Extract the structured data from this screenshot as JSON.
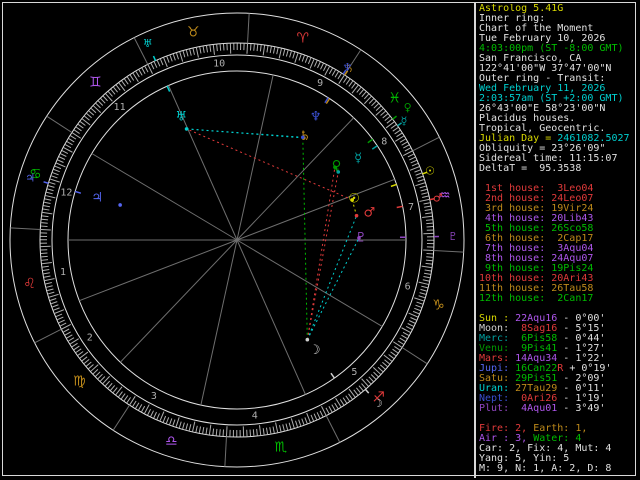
{
  "palette": {
    "white": "#E0E0E0",
    "ltgray": "#CFCFCF",
    "gray": "#AFAFAF",
    "dkgray": "#6E6E6E",
    "red": "#E03A3A",
    "yellow": "#D9D900",
    "green": "#00BB00",
    "dkgreen": "#009900",
    "cyan": "#00CFCF",
    "dkcyan": "#009F9F",
    "blue": "#5566F2",
    "dkblue": "#3A4FD0",
    "purple": "#AE56EC",
    "dkpurple": "#8F46C0",
    "brown": "#BE8A1A"
  },
  "sidebar": {
    "lines": [
      {
        "name": "app-title",
        "segs": [
          {
            "t": "Astrolog 5.41G",
            "c": "yellow"
          }
        ]
      },
      {
        "name": "info-line",
        "segs": [
          {
            "t": "Inner ring:",
            "c": "white"
          }
        ]
      },
      {
        "name": "info-line",
        "segs": [
          {
            "t": "Chart of the Moment",
            "c": "white"
          }
        ]
      },
      {
        "name": "inner-date",
        "segs": [
          {
            "t": "Tue February 10, 2026",
            "c": "white"
          }
        ]
      },
      {
        "name": "inner-time",
        "segs": [
          {
            "t": "4:03:00pm (ST -8:00 GMT)",
            "c": "green"
          }
        ]
      },
      {
        "name": "inner-location",
        "segs": [
          {
            "t": "San Francisco, CA",
            "c": "white"
          }
        ]
      },
      {
        "name": "inner-coords",
        "segs": [
          {
            "t": "122°41'00\"W 37°47'00\"N",
            "c": "white"
          }
        ]
      },
      {
        "name": "info-line",
        "segs": [
          {
            "t": "Outer ring - Transit:",
            "c": "white"
          }
        ]
      },
      {
        "name": "outer-date",
        "segs": [
          {
            "t": "Wed February 11, 2026",
            "c": "cyan"
          }
        ]
      },
      {
        "name": "outer-time",
        "segs": [
          {
            "t": "2:03:57am (ST +2:00 GMT)",
            "c": "cyan"
          }
        ]
      },
      {
        "name": "outer-coords",
        "segs": [
          {
            "t": "26°43'00\"E 58°23'00\"N",
            "c": "white"
          }
        ]
      },
      {
        "name": "house-system",
        "segs": [
          {
            "t": "Placidus houses.",
            "c": "white"
          }
        ]
      },
      {
        "name": "zodiac-system",
        "segs": [
          {
            "t": "Tropical, Geocentric.",
            "c": "white"
          }
        ]
      },
      {
        "name": "julian-day",
        "segs": [
          {
            "t": "Julian Day = ",
            "c": "yellow"
          },
          {
            "t": "2461082.5027",
            "c": "cyan"
          }
        ]
      },
      {
        "name": "obliquity",
        "segs": [
          {
            "t": "Obliquity = 23°26'09\"",
            "c": "white"
          }
        ]
      },
      {
        "name": "sidereal-time",
        "segs": [
          {
            "t": "Sidereal time: 11:15:07",
            "c": "white"
          }
        ]
      },
      {
        "name": "delta-t",
        "segs": [
          {
            "t": "DeltaT =  95.3538",
            "c": "white"
          }
        ]
      },
      {
        "name": "spacer",
        "segs": []
      },
      {
        "name": "house-cusp-row",
        "segs": [
          {
            "t": " 1st house:  3Leo04",
            "c": "red"
          }
        ]
      },
      {
        "name": "house-cusp-row",
        "segs": [
          {
            "t": " 2nd house: 24Leo07",
            "c": "red"
          }
        ]
      },
      {
        "name": "house-cusp-row",
        "segs": [
          {
            "t": " 3rd house: 19Vir24",
            "c": "brown"
          }
        ]
      },
      {
        "name": "house-cusp-row",
        "segs": [
          {
            "t": " 4th house: 20Lib43",
            "c": "purple"
          }
        ]
      },
      {
        "name": "house-cusp-row",
        "segs": [
          {
            "t": " 5th house: 26Sco58",
            "c": "green"
          }
        ]
      },
      {
        "name": "house-cusp-row",
        "segs": [
          {
            "t": " 6th house:  2Cap17",
            "c": "brown"
          }
        ]
      },
      {
        "name": "house-cusp-row",
        "segs": [
          {
            "t": " 7th house:  3Aqu04",
            "c": "purple"
          }
        ]
      },
      {
        "name": "house-cusp-row",
        "segs": [
          {
            "t": " 8th house: 24Aqu07",
            "c": "purple"
          }
        ]
      },
      {
        "name": "house-cusp-row",
        "segs": [
          {
            "t": " 9th house: 19Pis24",
            "c": "green"
          }
        ]
      },
      {
        "name": "house-cusp-row",
        "segs": [
          {
            "t": "10th house: 20Ari43",
            "c": "red"
          }
        ]
      },
      {
        "name": "house-cusp-row",
        "segs": [
          {
            "t": "11th house: 26Tau58",
            "c": "brown"
          }
        ]
      },
      {
        "name": "house-cusp-row",
        "segs": [
          {
            "t": "12th house:  2Can17",
            "c": "green"
          }
        ]
      },
      {
        "name": "spacer",
        "segs": []
      },
      {
        "name": "planet-row",
        "segs": [
          {
            "t": "Sun : ",
            "c": "yellow"
          },
          {
            "t": "22Aqu16",
            "c": "purple"
          },
          {
            "t": " - 0°00'",
            "c": "white"
          }
        ]
      },
      {
        "name": "planet-row",
        "segs": [
          {
            "t": "Moon: ",
            "c": "ltgray"
          },
          {
            "t": " 8Sag16",
            "c": "red"
          },
          {
            "t": " - 5°15'",
            "c": "white"
          }
        ]
      },
      {
        "name": "planet-row",
        "segs": [
          {
            "t": "Merc: ",
            "c": "dkcyan"
          },
          {
            "t": " 6Pis58",
            "c": "green"
          },
          {
            "t": " - 0°44'",
            "c": "white"
          }
        ]
      },
      {
        "name": "planet-row",
        "segs": [
          {
            "t": "Venu: ",
            "c": "dkgreen"
          },
          {
            "t": " 9Pis41",
            "c": "green"
          },
          {
            "t": " - 1°27'",
            "c": "white"
          }
        ]
      },
      {
        "name": "planet-row",
        "segs": [
          {
            "t": "Mars: ",
            "c": "red"
          },
          {
            "t": "14Aqu34",
            "c": "purple"
          },
          {
            "t": " - 1°22'",
            "c": "white"
          }
        ]
      },
      {
        "name": "planet-row",
        "segs": [
          {
            "t": "Jupi: ",
            "c": "blue"
          },
          {
            "t": "16Can22",
            "c": "green"
          },
          {
            "t": "R",
            "c": "red"
          },
          {
            "t": " + 0°19'",
            "c": "white"
          }
        ]
      },
      {
        "name": "planet-row",
        "segs": [
          {
            "t": "Satu: ",
            "c": "brown"
          },
          {
            "t": "29Pis51",
            "c": "green"
          },
          {
            "t": " - 2°09'",
            "c": "white"
          }
        ]
      },
      {
        "name": "planet-row",
        "segs": [
          {
            "t": "Uran: ",
            "c": "cyan"
          },
          {
            "t": "27Tau29",
            "c": "brown"
          },
          {
            "t": " - 0°11'",
            "c": "white"
          }
        ]
      },
      {
        "name": "planet-row",
        "segs": [
          {
            "t": "Nept: ",
            "c": "dkblue"
          },
          {
            "t": " 0Ari26",
            "c": "red"
          },
          {
            "t": " - 1°19'",
            "c": "white"
          }
        ]
      },
      {
        "name": "planet-row",
        "segs": [
          {
            "t": "Plut: ",
            "c": "dkpurple"
          },
          {
            "t": " 4Aqu01",
            "c": "purple"
          },
          {
            "t": " - 3°49'",
            "c": "white"
          }
        ]
      },
      {
        "name": "spacer",
        "segs": []
      },
      {
        "name": "stats-row",
        "segs": [
          {
            "t": "Fire: 2, ",
            "c": "red"
          },
          {
            "t": "Earth: 1,",
            "c": "brown"
          }
        ]
      },
      {
        "name": "stats-row",
        "segs": [
          {
            "t": "Air : 3, ",
            "c": "purple"
          },
          {
            "t": "Water: 4",
            "c": "green"
          }
        ]
      },
      {
        "name": "stats-row",
        "segs": [
          {
            "t": "Car: 2, Fix: 4, Mut: 4",
            "c": "white"
          }
        ]
      },
      {
        "name": "stats-row",
        "segs": [
          {
            "t": "Yang: 5, Yin: 5",
            "c": "white"
          }
        ]
      },
      {
        "name": "stats-row",
        "segs": [
          {
            "t": "M: 9, N: 1, A: 2, D: 8",
            "c": "white"
          }
        ]
      }
    ]
  },
  "chart": {
    "type": "astrology-biwheel",
    "asc_lon": 123.067,
    "signs": [
      {
        "name": "aries",
        "glyph": "♈",
        "element": "red"
      },
      {
        "name": "taurus",
        "glyph": "♉",
        "element": "brown"
      },
      {
        "name": "gemini",
        "glyph": "♊",
        "element": "purple"
      },
      {
        "name": "cancer",
        "glyph": "♋",
        "element": "green"
      },
      {
        "name": "leo",
        "glyph": "♌",
        "element": "red"
      },
      {
        "name": "virgo",
        "glyph": "♍",
        "element": "brown"
      },
      {
        "name": "libra",
        "glyph": "♎",
        "element": "purple"
      },
      {
        "name": "scorpio",
        "glyph": "♏",
        "element": "green"
      },
      {
        "name": "sagittarius",
        "glyph": "♐",
        "element": "red"
      },
      {
        "name": "capricorn",
        "glyph": "♑",
        "element": "brown"
      },
      {
        "name": "aquarius",
        "glyph": "♒",
        "element": "purple"
      },
      {
        "name": "pisces",
        "glyph": "♓",
        "element": "green"
      }
    ],
    "houses": [
      {
        "num": 1,
        "cusp": "3Leo04",
        "lon": 123.067
      },
      {
        "num": 2,
        "cusp": "24Leo07",
        "lon": 144.117
      },
      {
        "num": 3,
        "cusp": "19Vir24",
        "lon": 169.4
      },
      {
        "num": 4,
        "cusp": "20Lib43",
        "lon": 200.717
      },
      {
        "num": 5,
        "cusp": "26Sco58",
        "lon": 236.967
      },
      {
        "num": 6,
        "cusp": "2Cap17",
        "lon": 272.283
      },
      {
        "num": 7,
        "cusp": "3Aqu04",
        "lon": 303.067
      },
      {
        "num": 8,
        "cusp": "24Aqu07",
        "lon": 324.117
      },
      {
        "num": 9,
        "cusp": "19Pis24",
        "lon": 349.4
      },
      {
        "num": 10,
        "cusp": "20Ari43",
        "lon": 20.717
      },
      {
        "num": 11,
        "cusp": "26Tau58",
        "lon": 56.967
      },
      {
        "num": 12,
        "cusp": "2Can17",
        "lon": 92.283
      }
    ],
    "planets": [
      {
        "name": "sun",
        "glyph": "☉",
        "color": "yellow",
        "pos": "22Aqu16",
        "lon": 322.27,
        "transit_lon": 322.69,
        "retro": false
      },
      {
        "name": "moon",
        "glyph": "☽",
        "color": "ltgray",
        "pos": "8Sag16",
        "lon": 248.27,
        "transit_lon": 253.77,
        "retro": false
      },
      {
        "name": "merc",
        "glyph": "☿",
        "color": "dkcyan",
        "pos": "6Pis58",
        "lon": 336.97,
        "transit_lon": 338.5,
        "retro": false
      },
      {
        "name": "venu",
        "glyph": "♀",
        "color": "dkgreen",
        "pos": "9Pis41",
        "lon": 339.68,
        "transit_lon": 340.9,
        "retro": false
      },
      {
        "name": "mars",
        "glyph": "♂",
        "color": "red",
        "pos": "14Aqu34",
        "lon": 314.57,
        "transit_lon": 314.88,
        "retro": false
      },
      {
        "name": "jupi",
        "glyph": "♃",
        "color": "blue",
        "pos": "16Can22",
        "lon": 106.37,
        "transit_lon": 106.33,
        "retro": true
      },
      {
        "name": "satu",
        "glyph": "♄",
        "color": "brown",
        "pos": "29Pis51",
        "lon": 359.85,
        "transit_lon": 359.9,
        "retro": false
      },
      {
        "name": "uran",
        "glyph": "♅",
        "color": "cyan",
        "pos": "27Tau29",
        "lon": 57.48,
        "transit_lon": 57.49,
        "retro": false
      },
      {
        "name": "nept",
        "glyph": "♆",
        "color": "dkblue",
        "pos": "0Ari26",
        "lon": 0.43,
        "transit_lon": 0.45,
        "retro": false
      },
      {
        "name": "plut",
        "glyph": "♇",
        "color": "dkpurple",
        "pos": "4Aqu01",
        "lon": 304.02,
        "transit_lon": 304.05,
        "retro": false
      }
    ],
    "aspects": [
      {
        "a": "satu",
        "b": "nept",
        "type": "conjunction",
        "color": "yellow"
      },
      {
        "a": "merc",
        "b": "venu",
        "type": "conjunction",
        "color": "yellow"
      },
      {
        "a": "sun",
        "b": "mars",
        "type": "conjunction",
        "color": "yellow"
      },
      {
        "a": "uran",
        "b": "satu",
        "type": "sextile",
        "color": "cyan"
      },
      {
        "a": "uran",
        "b": "nept",
        "type": "sextile",
        "color": "cyan"
      },
      {
        "a": "moon",
        "b": "plut",
        "type": "sextile",
        "color": "cyan"
      },
      {
        "a": "moon",
        "b": "mars",
        "type": "sextile",
        "color": "cyan"
      },
      {
        "a": "moon",
        "b": "venu",
        "type": "square",
        "color": "red"
      },
      {
        "a": "moon",
        "b": "merc",
        "type": "square",
        "color": "red"
      },
      {
        "a": "sun",
        "b": "uran",
        "type": "square",
        "color": "red"
      },
      {
        "a": "moon",
        "b": "nept",
        "type": "trine",
        "color": "green"
      }
    ]
  }
}
